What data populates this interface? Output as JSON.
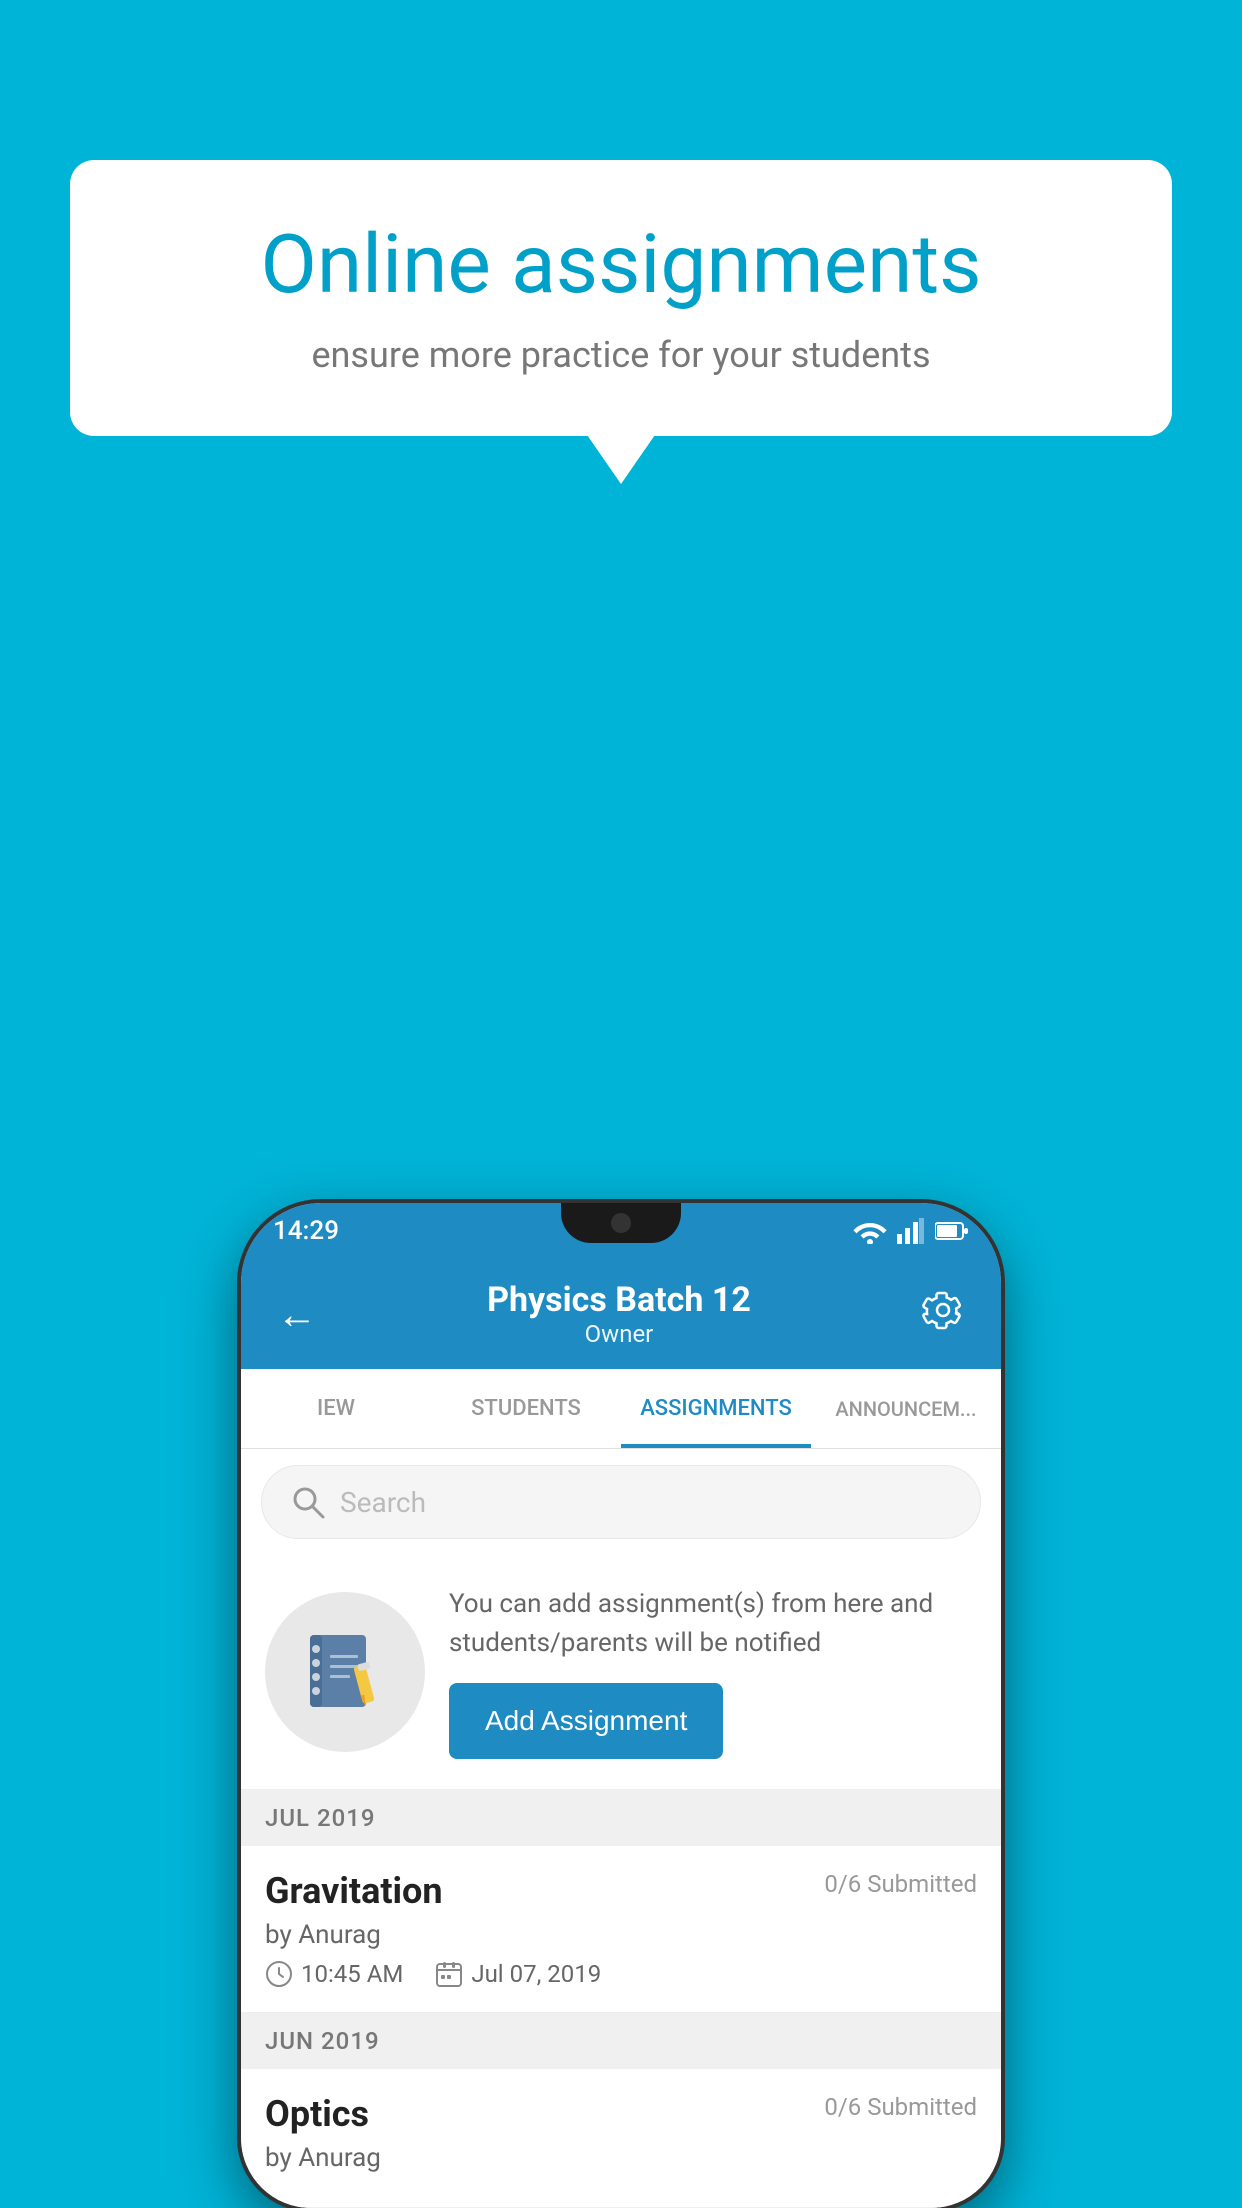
{
  "background_color": "#00B4D8",
  "speech_bubble": {
    "title": "Online assignments",
    "subtitle": "ensure more practice for your students"
  },
  "phone": {
    "status_bar": {
      "time": "14:29"
    },
    "app_bar": {
      "title": "Physics Batch 12",
      "subtitle": "Owner",
      "back_icon": "←",
      "settings_icon": "⚙"
    },
    "tabs": [
      {
        "label": "IEW",
        "active": false
      },
      {
        "label": "STUDENTS",
        "active": false
      },
      {
        "label": "ASSIGNMENTS",
        "active": true
      },
      {
        "label": "ANNOUNCEM...",
        "active": false
      }
    ],
    "search": {
      "placeholder": "Search"
    },
    "promo": {
      "text": "You can add assignment(s) from here and students/parents will be notified",
      "button_label": "Add Assignment"
    },
    "sections": [
      {
        "month": "JUL 2019",
        "assignments": [
          {
            "name": "Gravitation",
            "submitted": "0/6 Submitted",
            "by": "by Anurag",
            "time": "10:45 AM",
            "date": "Jul 07, 2019"
          }
        ]
      },
      {
        "month": "JUN 2019",
        "assignments": [
          {
            "name": "Optics",
            "submitted": "0/6 Submitted",
            "by": "by Anurag",
            "time": "",
            "date": ""
          }
        ]
      }
    ]
  }
}
